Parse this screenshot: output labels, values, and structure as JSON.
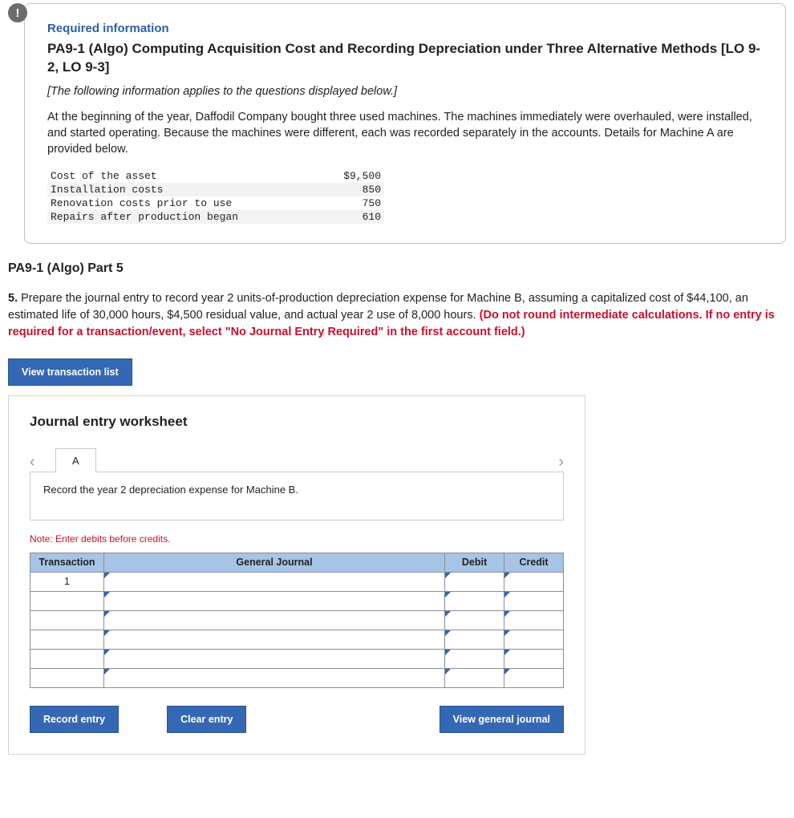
{
  "info": {
    "required_label": "Required information",
    "title": "PA9-1 (Algo) Computing Acquisition Cost and Recording Depreciation under Three Alternative Methods [LO 9-2, LO 9-3]",
    "italics_note": "[The following information applies to the questions displayed below.]",
    "paragraph": "At the beginning of the year, Daffodil Company bought three used machines. The machines immediately were overhauled, were installed, and started operating. Because the machines were different, each was recorded separately in the accounts. Details for Machine A are provided below."
  },
  "costs": [
    {
      "label": "Cost of the asset",
      "value": "$9,500"
    },
    {
      "label": "Installation costs",
      "value": "850"
    },
    {
      "label": "Renovation costs prior to use",
      "value": "750"
    },
    {
      "label": "Repairs after production began",
      "value": "610"
    }
  ],
  "part_title": "PA9-1 (Algo) Part 5",
  "question5": {
    "num": "5.",
    "body": " Prepare the journal entry to record year 2 units-of-production depreciation expense for Machine B, assuming a capitalized cost of $44,100, an estimated life of 30,000 hours, $4,500 residual value, and actual year 2 use of 8,000 hours. ",
    "warn": "(Do not round intermediate calculations. If no entry is required for a transaction/event, select \"No Journal Entry Required\" in the first account field.)"
  },
  "buttons": {
    "view_list": "View transaction list",
    "record": "Record entry",
    "clear": "Clear entry",
    "view_journal": "View general journal"
  },
  "worksheet": {
    "title": "Journal entry worksheet",
    "tab": "A",
    "instruction": "Record the year 2 depreciation expense for Machine B.",
    "note": "Note: Enter debits before credits.",
    "headers": {
      "trans": "Transaction",
      "gj": "General Journal",
      "debit": "Debit",
      "credit": "Credit"
    },
    "first_trans": "1"
  }
}
